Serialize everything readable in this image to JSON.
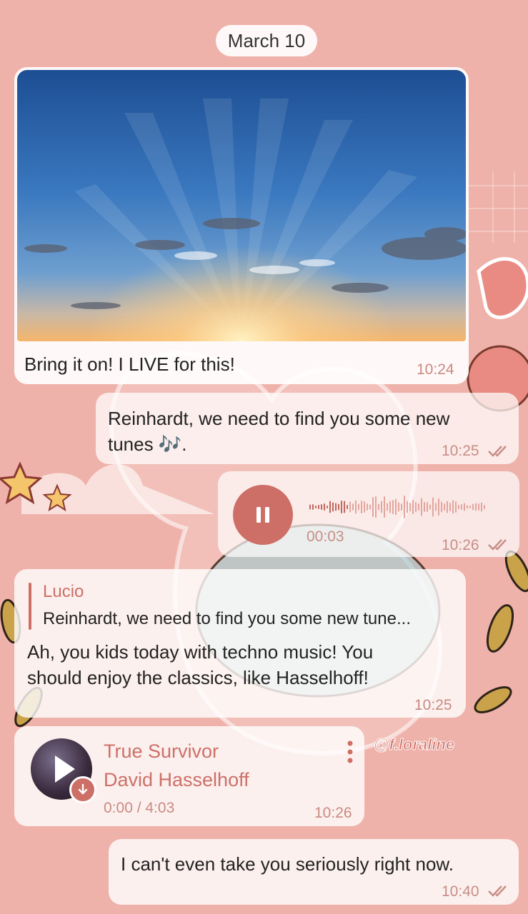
{
  "chat": {
    "date_label": "March 10",
    "watermark": "@f.loraline",
    "messages": {
      "photo": {
        "caption": "Bring it on! I LIVE for this!",
        "time": "10:24"
      },
      "tunes": {
        "text_line1": "Reinhardt, we need to find you some new",
        "text_line2": "tunes 🎶.",
        "time": "10:25"
      },
      "voice": {
        "elapsed": "00:03",
        "time": "10:26",
        "progress": 0.22
      },
      "reply": {
        "quote_author": "Lucio",
        "quote_text": "Reinhardt, we need to find you some new tune...",
        "text_line1": "Ah, you kids today with techno music! You",
        "text_line2": "should enjoy the classics, like Hasselhoff!",
        "time": "10:25"
      },
      "music": {
        "title": "True Survivor",
        "artist": "David Hasselhoff",
        "progress_text": "0:00 / 4:03",
        "time": "10:26"
      },
      "last": {
        "text": "I can't even take you seriously right now.",
        "time": "10:40"
      }
    }
  },
  "colors": {
    "accent": "#cd6f66",
    "background": "#efb2aa",
    "time_text": "#c78e86"
  },
  "icons": [
    "pause-icon",
    "play-icon",
    "download-icon",
    "more-vert-icon",
    "double-check-icon"
  ]
}
